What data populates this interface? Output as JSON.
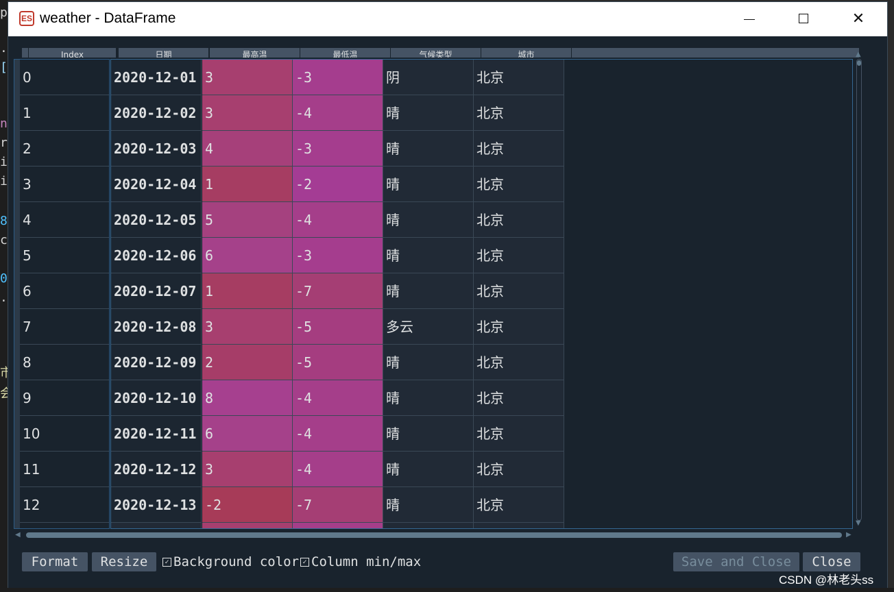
{
  "window": {
    "title": "weather - DataFrame",
    "app_icon": "spyder-icon"
  },
  "controls": {
    "minimize": "—",
    "close": "✕"
  },
  "bg_editor_chars": [
    "p",
    ".",
    "[",
    "n",
    "r",
    "i",
    "i",
    "8",
    "c",
    "0",
    ".",
    "市",
    "会"
  ],
  "table": {
    "headers": [
      "Index",
      "日期",
      "最高温",
      "最低温",
      "气候类型",
      "城市"
    ],
    "rows": [
      {
        "index": "0",
        "date": "2020-12-01",
        "high": "3",
        "low": "-3",
        "weather": "阴",
        "city": "北京"
      },
      {
        "index": "1",
        "date": "2020-12-02",
        "high": "3",
        "low": "-4",
        "weather": "晴",
        "city": "北京"
      },
      {
        "index": "2",
        "date": "2020-12-03",
        "high": "4",
        "low": "-3",
        "weather": "晴",
        "city": "北京"
      },
      {
        "index": "3",
        "date": "2020-12-04",
        "high": "1",
        "low": "-2",
        "weather": "晴",
        "city": "北京"
      },
      {
        "index": "4",
        "date": "2020-12-05",
        "high": "5",
        "low": "-4",
        "weather": "晴",
        "city": "北京"
      },
      {
        "index": "5",
        "date": "2020-12-06",
        "high": "6",
        "low": "-3",
        "weather": "晴",
        "city": "北京"
      },
      {
        "index": "6",
        "date": "2020-12-07",
        "high": "1",
        "low": "-7",
        "weather": "晴",
        "city": "北京"
      },
      {
        "index": "7",
        "date": "2020-12-08",
        "high": "3",
        "low": "-5",
        "weather": "多云",
        "city": "北京"
      },
      {
        "index": "8",
        "date": "2020-12-09",
        "high": "2",
        "low": "-5",
        "weather": "晴",
        "city": "北京"
      },
      {
        "index": "9",
        "date": "2020-12-10",
        "high": "8",
        "low": "-4",
        "weather": "晴",
        "city": "北京"
      },
      {
        "index": "10",
        "date": "2020-12-11",
        "high": "6",
        "low": "-4",
        "weather": "晴",
        "city": "北京"
      },
      {
        "index": "11",
        "date": "2020-12-12",
        "high": "3",
        "low": "-4",
        "weather": "晴",
        "city": "北京"
      },
      {
        "index": "12",
        "date": "2020-12-13",
        "high": "-2",
        "low": "-7",
        "weather": "晴",
        "city": "北京"
      }
    ],
    "high_colors": [
      "#a73f6f",
      "#a73f6f",
      "#a6407a",
      "#a63d62",
      "#a5417f",
      "#a5418a",
      "#a63d62",
      "#a73f6f",
      "#a63d68",
      "#a6408f",
      "#a5418a",
      "#a73f6f",
      "#a73b58"
    ],
    "low_colors": [
      "#a53d8e",
      "#a53e8a",
      "#a53d8e",
      "#a43c94",
      "#a53e8a",
      "#a53d8e",
      "#a53e74",
      "#a53d80",
      "#a53d80",
      "#a53e8a",
      "#a53e8a",
      "#a53e8a",
      "#a53e74"
    ]
  },
  "bottom_bar": {
    "format_label": "Format",
    "resize_label": "Resize",
    "bg_color_label": "Background color",
    "col_minmax_label": "Column min/max",
    "save_close_label": "Save and Close",
    "close_label": "Close"
  },
  "watermark": "CSDN @林老头ss"
}
